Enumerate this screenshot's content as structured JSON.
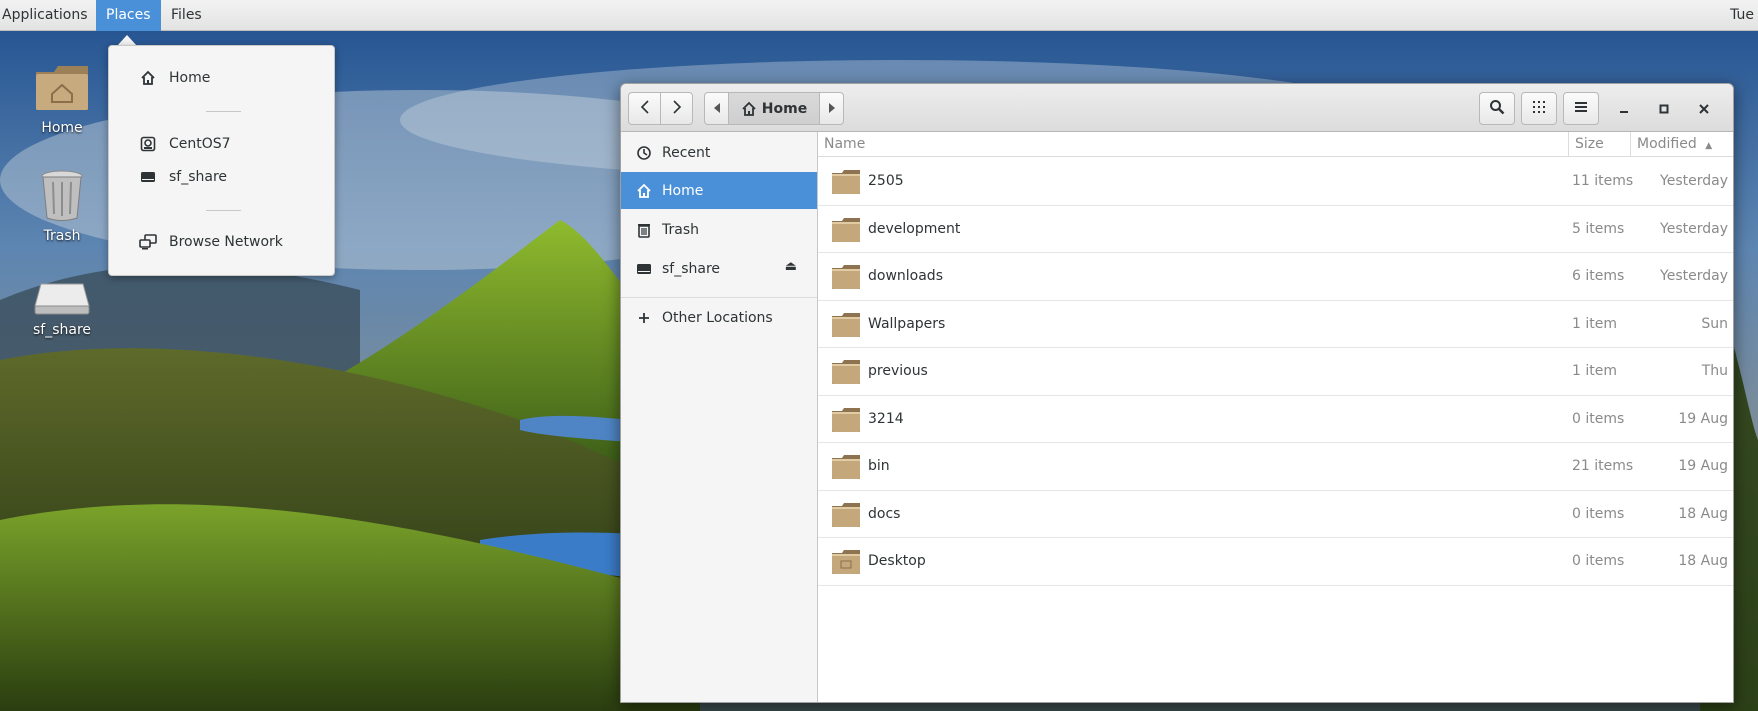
{
  "topbar": {
    "applications": "Applications",
    "places": "Places",
    "files": "Files",
    "clock": "Tue"
  },
  "desktop": {
    "icons": [
      {
        "label": "Home",
        "icon": "home-folder-icon"
      },
      {
        "label": "Trash",
        "icon": "trash-icon"
      },
      {
        "label": "sf_share",
        "icon": "drive-icon"
      }
    ]
  },
  "places_menu": {
    "items": [
      {
        "label": "Home",
        "icon": "home-icon"
      },
      {
        "label": "CentOS7",
        "icon": "disc-icon"
      },
      {
        "label": "sf_share",
        "icon": "drive-icon"
      },
      {
        "label": "Browse Network",
        "icon": "network-icon"
      }
    ]
  },
  "file_manager": {
    "path": {
      "current": "Home"
    },
    "sidebar": [
      {
        "label": "Recent",
        "icon": "clock-icon",
        "active": false
      },
      {
        "label": "Home",
        "icon": "home-icon",
        "active": true
      },
      {
        "label": "Trash",
        "icon": "trash-icon",
        "active": false
      },
      {
        "label": "sf_share",
        "icon": "drive-icon",
        "active": false,
        "eject": "⏏"
      },
      {
        "label": "Other Locations",
        "icon": "plus-icon",
        "active": false
      }
    ],
    "columns": {
      "name": "Name",
      "size": "Size",
      "modified": "Modified"
    },
    "rows": [
      {
        "name": "2505",
        "size": "11 items",
        "modified": "Yesterday"
      },
      {
        "name": "development",
        "size": "5 items",
        "modified": "Yesterday"
      },
      {
        "name": "downloads",
        "size": "6 items",
        "modified": "Yesterday"
      },
      {
        "name": "Wallpapers",
        "size": "1 item",
        "modified": "Sun"
      },
      {
        "name": "previous",
        "size": "1 item",
        "modified": "Thu"
      },
      {
        "name": "3214",
        "size": "0 items",
        "modified": "19 Aug"
      },
      {
        "name": "bin",
        "size": "21 items",
        "modified": "19 Aug"
      },
      {
        "name": "docs",
        "size": "0 items",
        "modified": "18 Aug"
      },
      {
        "name": "Desktop",
        "size": "0 items",
        "modified": "18 Aug"
      }
    ]
  },
  "colors": {
    "accent": "#4a90d9",
    "folder": "#b89a6d"
  }
}
